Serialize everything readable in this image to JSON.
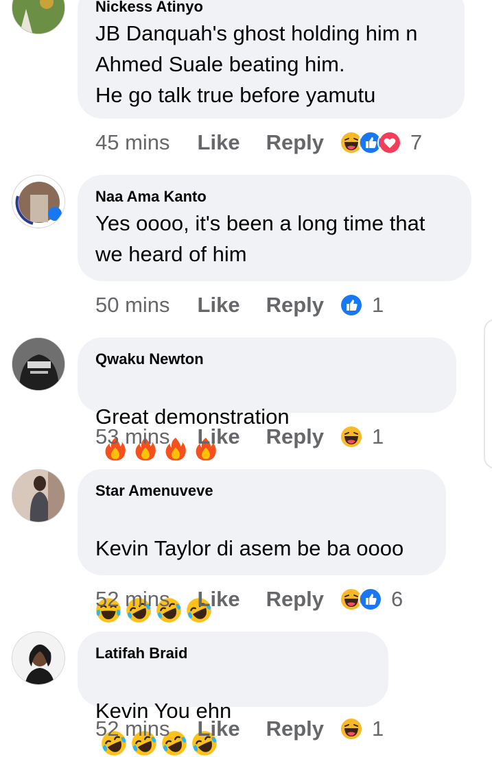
{
  "comments": [
    {
      "author": "Nickess Atinyo",
      "text": "JB Danquah's ghost holding him n\nAhmed Suale beating him.\nHe go talk true before yamutu",
      "time": "45 mins",
      "like": "Like",
      "reply": "Reply",
      "reactions": [
        "haha",
        "like",
        "love"
      ],
      "count": "7"
    },
    {
      "author": "Naa Ama Kanto",
      "text": "Yes oooo, it's been a long time that\nwe heard of him",
      "time": "50 mins",
      "like": "Like",
      "reply": "Reply",
      "reactions": [
        "like"
      ],
      "count": "1"
    },
    {
      "author": "Qwaku Newton",
      "text": "Great demonstration",
      "emoji": [
        "fire",
        "fire",
        "fire",
        "fire"
      ],
      "time": "53 mins",
      "like": "Like",
      "reply": "Reply",
      "reactions": [
        "haha"
      ],
      "count": "1"
    },
    {
      "author": "Star Amenuveve",
      "text": "Kevin Taylor di asem be ba oooo",
      "emoji": [
        "joy",
        "rofl",
        "rofl",
        "rofl"
      ],
      "time": "52 mins",
      "like": "Like",
      "reply": "Reply",
      "reactions": [
        "haha",
        "like"
      ],
      "count": "6"
    },
    {
      "author": "Latifah Braid",
      "text": "Kevin You ehn",
      "emoji": [
        "rofl",
        "rofl",
        "rofl",
        "rofl"
      ],
      "time": "52 mins",
      "like": "Like",
      "reply": "Reply",
      "reactions": [
        "haha"
      ],
      "count": "1"
    }
  ],
  "colors": {
    "bubble": "#f0f2f5",
    "meta": "#65676b",
    "like_blue": "#1877f2",
    "love_red": "#f33e58",
    "haha_yellow": "#f7b928"
  }
}
